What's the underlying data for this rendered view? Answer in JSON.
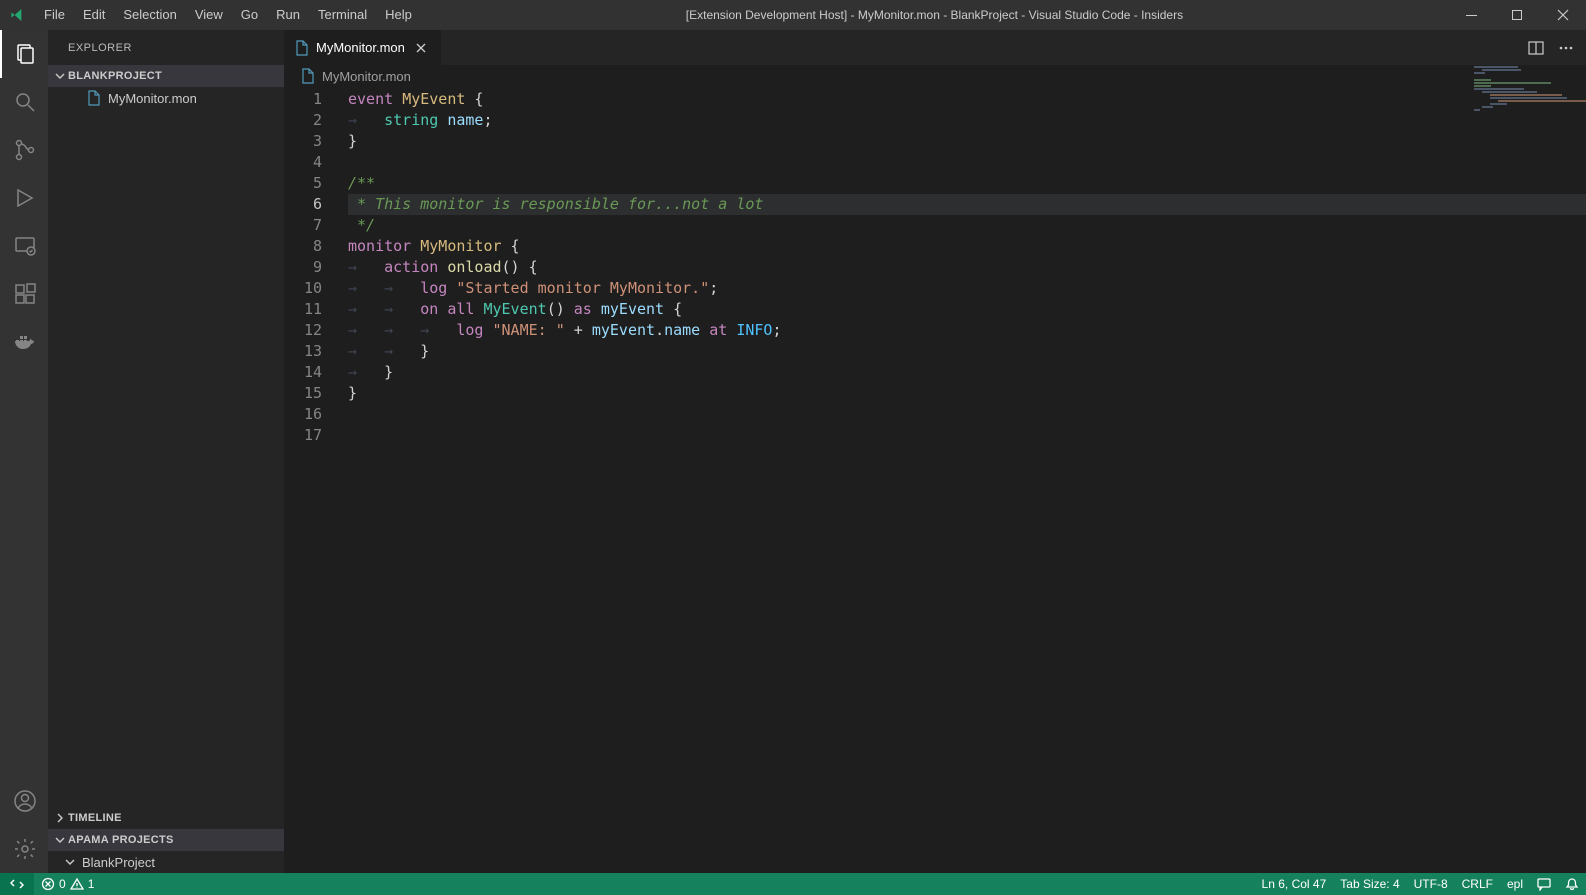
{
  "titlebar": {
    "title": "[Extension Development Host] - MyMonitor.mon - BlankProject - Visual Studio Code - Insiders",
    "menu": [
      "File",
      "Edit",
      "Selection",
      "View",
      "Go",
      "Run",
      "Terminal",
      "Help"
    ]
  },
  "sidebar": {
    "title": "EXPLORER",
    "project_section": "BLANKPROJECT",
    "files": [
      "MyMonitor.mon"
    ],
    "timeline_section": "TIMELINE",
    "apama_section": "APAMA PROJECTS",
    "apama_project": "BlankProject"
  },
  "tab": {
    "filename": "MyMonitor.mon"
  },
  "breadcrumb": {
    "filename": "MyMonitor.mon"
  },
  "code": {
    "lines": [
      {
        "n": 1,
        "tokens": [
          {
            "t": "event ",
            "c": "k-keyword"
          },
          {
            "t": "MyEvent",
            "c": "k-class"
          },
          {
            "t": " {",
            "c": "k-punct"
          }
        ]
      },
      {
        "n": 2,
        "tokens": [
          {
            "t": "    ",
            "c": "ws"
          },
          {
            "t": "string",
            "c": "k-type"
          },
          {
            "t": " ",
            "c": ""
          },
          {
            "t": "name",
            "c": "k-var"
          },
          {
            "t": ";",
            "c": "k-punct"
          }
        ]
      },
      {
        "n": 3,
        "tokens": [
          {
            "t": "}",
            "c": "k-punct"
          }
        ]
      },
      {
        "n": 4,
        "tokens": []
      },
      {
        "n": 5,
        "tokens": [
          {
            "t": "/**",
            "c": "k-comment"
          }
        ]
      },
      {
        "n": 6,
        "active": true,
        "tokens": [
          {
            "t": " * This monitor is responsible for...not a lot",
            "c": "k-comment"
          }
        ]
      },
      {
        "n": 7,
        "tokens": [
          {
            "t": " */",
            "c": "k-comment"
          }
        ]
      },
      {
        "n": 8,
        "tokens": [
          {
            "t": "monitor",
            "c": "k-keyword"
          },
          {
            "t": " ",
            "c": ""
          },
          {
            "t": "MyMonitor",
            "c": "k-class"
          },
          {
            "t": " {",
            "c": "k-punct"
          }
        ]
      },
      {
        "n": 9,
        "tokens": [
          {
            "t": "    ",
            "c": "ws"
          },
          {
            "t": "action",
            "c": "k-keyword"
          },
          {
            "t": " ",
            "c": ""
          },
          {
            "t": "onload",
            "c": "k-func"
          },
          {
            "t": "() {",
            "c": "k-punct"
          }
        ]
      },
      {
        "n": 10,
        "tokens": [
          {
            "t": "        ",
            "c": "ws"
          },
          {
            "t": "log ",
            "c": "k-keyword"
          },
          {
            "t": "\"Started monitor MyMonitor.\"",
            "c": "k-string"
          },
          {
            "t": ";",
            "c": "k-punct"
          }
        ]
      },
      {
        "n": 11,
        "tokens": [
          {
            "t": "        ",
            "c": "ws"
          },
          {
            "t": "on",
            "c": "k-keyword"
          },
          {
            "t": " ",
            "c": ""
          },
          {
            "t": "all",
            "c": "k-keyword"
          },
          {
            "t": " ",
            "c": ""
          },
          {
            "t": "MyEvent",
            "c": "k-type"
          },
          {
            "t": "() ",
            "c": "k-punct"
          },
          {
            "t": "as",
            "c": "k-keyword"
          },
          {
            "t": " ",
            "c": ""
          },
          {
            "t": "myEvent",
            "c": "k-var"
          },
          {
            "t": " {",
            "c": "k-punct"
          }
        ]
      },
      {
        "n": 12,
        "tokens": [
          {
            "t": "            ",
            "c": "ws"
          },
          {
            "t": "log ",
            "c": "k-keyword"
          },
          {
            "t": "\"NAME: \"",
            "c": "k-string"
          },
          {
            "t": " + ",
            "c": "k-punct"
          },
          {
            "t": "myEvent",
            "c": "k-var"
          },
          {
            "t": ".",
            "c": "k-punct"
          },
          {
            "t": "name",
            "c": "k-prop"
          },
          {
            "t": " ",
            "c": ""
          },
          {
            "t": "at",
            "c": "k-keyword"
          },
          {
            "t": " ",
            "c": ""
          },
          {
            "t": "INFO",
            "c": "k-const"
          },
          {
            "t": ";",
            "c": "k-punct"
          }
        ]
      },
      {
        "n": 13,
        "tokens": [
          {
            "t": "        ",
            "c": "ws"
          },
          {
            "t": "}",
            "c": "k-punct"
          }
        ]
      },
      {
        "n": 14,
        "tokens": [
          {
            "t": "    ",
            "c": "ws"
          },
          {
            "t": "}",
            "c": "k-punct"
          }
        ]
      },
      {
        "n": 15,
        "tokens": [
          {
            "t": "}",
            "c": "k-punct"
          }
        ]
      },
      {
        "n": 16,
        "tokens": []
      },
      {
        "n": 17,
        "tokens": []
      }
    ]
  },
  "statusbar": {
    "errors": "0",
    "warnings": "1",
    "cursor": "Ln 6, Col 47",
    "tabsize": "Tab Size: 4",
    "encoding": "UTF-8",
    "eol": "CRLF",
    "language": "epl"
  }
}
